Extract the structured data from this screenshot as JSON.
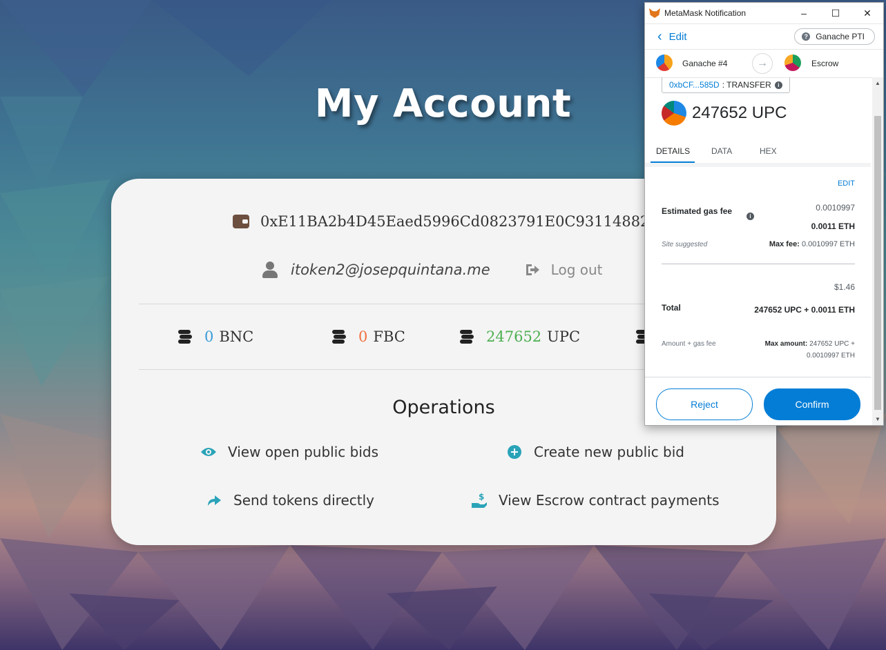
{
  "page": {
    "title": "My Account"
  },
  "account": {
    "address": "0xE11BA2b4D45Eaed5996Cd0823791E0C93114882",
    "email": "itoken2@josepquintana.me",
    "logout_label": "Log out"
  },
  "tokens": [
    {
      "amount": "0",
      "symbol": "BNC",
      "color": "#3a9bd8"
    },
    {
      "amount": "0",
      "symbol": "FBC",
      "color": "#f07040"
    },
    {
      "amount": "247652",
      "symbol": "UPC",
      "color": "#4caf50"
    }
  ],
  "operations": {
    "title": "Operations",
    "view_bids": "View open public bids",
    "create_bid": "Create new public bid",
    "send_tokens": "Send tokens directly",
    "escrow_payments": "View Escrow contract payments"
  },
  "metamask": {
    "window_title": "MetaMask Notification",
    "minimize": "–",
    "maximize": "☐",
    "close": "✕",
    "edit": "Edit",
    "network": "Ganache PTI",
    "from_account": "Ganache #4",
    "to_account": "Escrow",
    "method_address": "0xbCF...585D",
    "method_name": ": TRANSFER",
    "amount": "247652 UPC",
    "tabs": [
      "DETAILS",
      "DATA",
      "HEX"
    ],
    "details": {
      "edit": "EDIT",
      "gas_label": "Estimated gas fee",
      "gas_value_small": "0.0010997",
      "gas_value": "0.0011 ETH",
      "site_suggested": "Site suggested",
      "max_fee_label": "Max fee:",
      "max_fee_value": "0.0010997 ETH",
      "total_fiat": "$1.46",
      "total_label": "Total",
      "total_value": "247652 UPC + 0.0011 ETH",
      "amount_gas_label": "Amount + gas fee",
      "max_amount_label": "Max amount:",
      "max_amount_value": "247652 UPC + 0.0010997 ETH"
    },
    "reject": "Reject",
    "confirm": "Confirm",
    "accent_color": "#037dd6"
  }
}
